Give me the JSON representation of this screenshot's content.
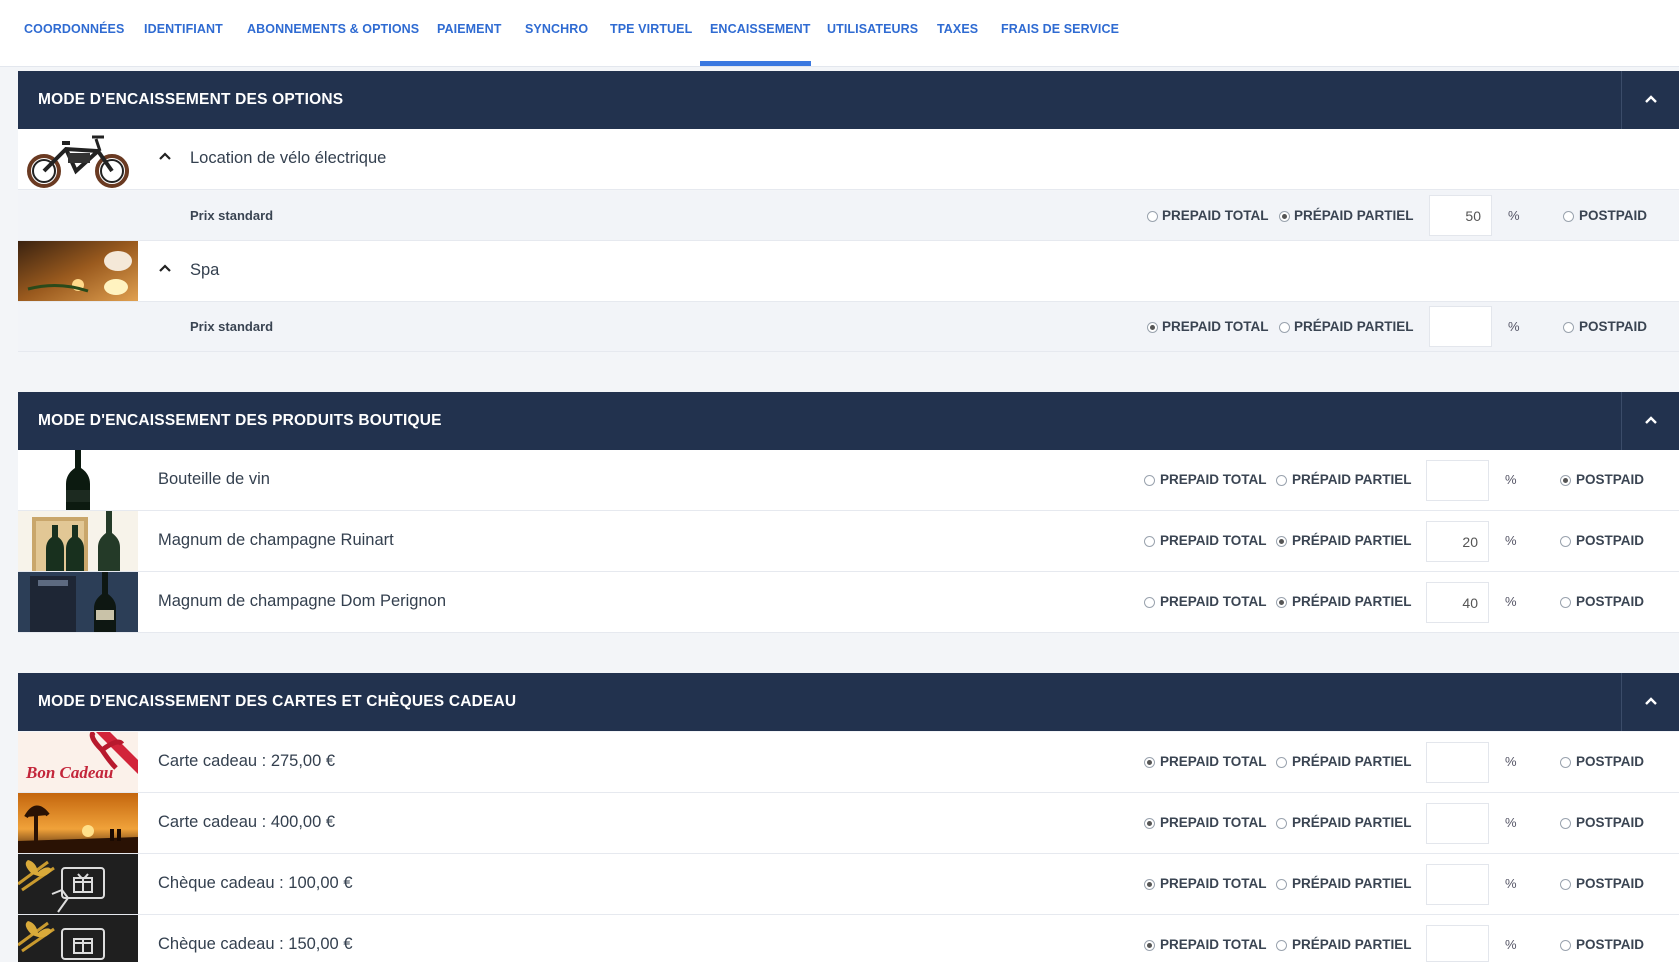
{
  "tabs": [
    "COORDONNÉES",
    "IDENTIFIANT",
    "ABONNEMENTS & OPTIONS",
    "PAIEMENT",
    "SYNCHRO",
    "TPE VIRTUEL",
    "ENCAISSEMENT",
    "UTILISATEURS",
    "TAXES",
    "FRAIS DE SERVICE"
  ],
  "active_tab": "ENCAISSEMENT",
  "labels": {
    "prepaid_total": "PREPAID TOTAL",
    "prepaid_partiel": "PRÉPAID PARTIEL",
    "postpaid": "POSTPAID",
    "percent": "%",
    "prix_standard": "Prix standard"
  },
  "sections": {
    "options": {
      "title": "MODE D'ENCAISSEMENT DES OPTIONS",
      "items": [
        {
          "name": "Location de vélo électrique",
          "thumb": "electric-bike-image",
          "sub": {
            "label": "Prix standard",
            "mode": "partiel",
            "percent": "50"
          }
        },
        {
          "name": "Spa",
          "thumb": "spa-candles-image",
          "sub": {
            "label": "Prix standard",
            "mode": "total",
            "percent": ""
          }
        }
      ]
    },
    "boutique": {
      "title": "MODE D'ENCAISSEMENT DES PRODUITS BOUTIQUE",
      "items": [
        {
          "name": "Bouteille de vin",
          "thumb": "wine-bottle-image",
          "mode": "postpaid",
          "percent": ""
        },
        {
          "name": "Magnum de champagne Ruinart",
          "thumb": "ruinart-champagne-image",
          "mode": "partiel",
          "percent": "20"
        },
        {
          "name": "Magnum de champagne Dom Perignon",
          "thumb": "dom-perignon-image",
          "mode": "partiel",
          "percent": "40"
        }
      ]
    },
    "cadeaux": {
      "title": "MODE D'ENCAISSEMENT DES CARTES ET CHÈQUES CADEAU",
      "items": [
        {
          "name": "Carte cadeau : 275,00 €",
          "thumb": "bon-cadeau-image",
          "thumb_text": "Bon Cadeau",
          "mode": "total",
          "percent": ""
        },
        {
          "name": "Carte cadeau : 400,00 €",
          "thumb": "sunset-image",
          "mode": "total",
          "percent": ""
        },
        {
          "name": "Chèque cadeau : 100,00 €",
          "thumb": "gift-cheque-image",
          "mode": "total",
          "percent": ""
        },
        {
          "name": "Chèque cadeau : 150,00 €",
          "thumb": "gift-cheque-image",
          "mode": "total",
          "percent": ""
        }
      ]
    }
  },
  "colors": {
    "header_bg": "#22324e",
    "tab_text": "#2f6bd2",
    "tab_underline": "#3a78e0"
  }
}
